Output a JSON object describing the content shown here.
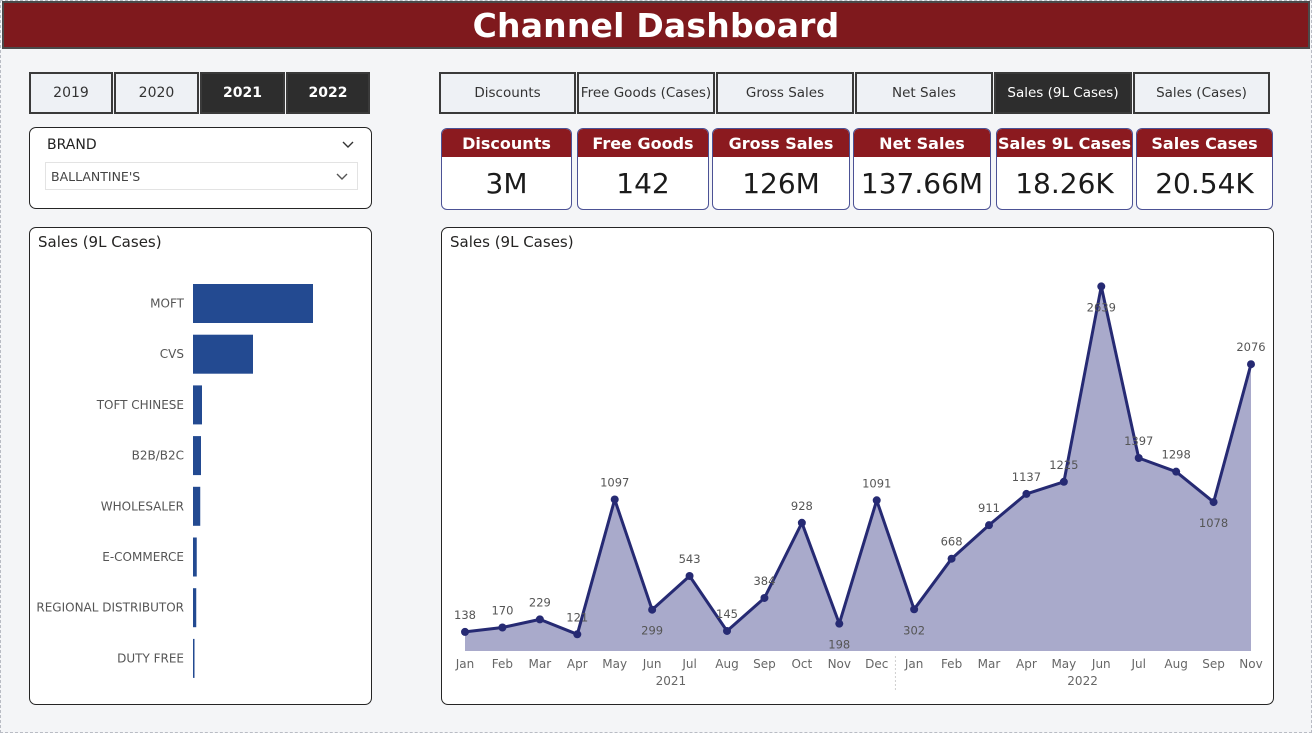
{
  "header": {
    "title": "Channel Dashboard"
  },
  "years": [
    {
      "label": "2019",
      "active": false
    },
    {
      "label": "2020",
      "active": false
    },
    {
      "label": "2021",
      "active": true
    },
    {
      "label": "2022",
      "active": true
    }
  ],
  "metric_tabs": [
    {
      "label": "Discounts",
      "active": false
    },
    {
      "label": "Free Goods (Cases)",
      "active": false
    },
    {
      "label": "Gross Sales",
      "active": false
    },
    {
      "label": "Net Sales",
      "active": false
    },
    {
      "label": "Sales (9L Cases)",
      "active": true
    },
    {
      "label": "Sales (Cases)",
      "active": false
    }
  ],
  "slicer": {
    "title": "BRAND",
    "selected": "BALLANTINE'S"
  },
  "cards": [
    {
      "label": "Discounts",
      "value": "3M"
    },
    {
      "label": "Free Goods",
      "value": "142"
    },
    {
      "label": "Gross Sales",
      "value": "126M"
    },
    {
      "label": "Net Sales",
      "value": "137.66M"
    },
    {
      "label": "Sales 9L Cases",
      "value": "18.26K"
    },
    {
      "label": "Sales Cases",
      "value": "20.54K"
    }
  ],
  "colors": {
    "title_bar": "#7f191d",
    "card_header": "#8b1a1f",
    "bar": "#234a91",
    "line": "#262a73",
    "area": "#a9aacb"
  },
  "chart_data": [
    {
      "type": "bar",
      "orientation": "horizontal",
      "title": "Sales (9L Cases)",
      "categories": [
        "MOFT",
        "CVS",
        "TOFT CHINESE",
        "B2B/B2C",
        "WHOLESALER",
        "E-COMMERCE",
        "REGIONAL DISTRIBUTOR",
        "DUTY FREE"
      ],
      "values": [
        9600,
        4800,
        720,
        640,
        580,
        300,
        260,
        120
      ]
    },
    {
      "type": "area",
      "title": "Sales (9L Cases)",
      "x_level1": [
        "Jan",
        "Feb",
        "Mar",
        "Apr",
        "May",
        "Jun",
        "Jul",
        "Aug",
        "Sep",
        "Oct",
        "Nov",
        "Dec",
        "Jan",
        "Feb",
        "Mar",
        "Apr",
        "May",
        "Jun",
        "Jul",
        "Aug",
        "Sep",
        "Nov"
      ],
      "x_level2": [
        {
          "label": "2021",
          "from": 0,
          "to": 11
        },
        {
          "label": "2022",
          "from": 12,
          "to": 21
        }
      ],
      "values": [
        138,
        170,
        229,
        121,
        1097,
        299,
        543,
        145,
        384,
        928,
        198,
        1091,
        302,
        668,
        911,
        1137,
        1225,
        2639,
        1397,
        1298,
        1078,
        2076
      ],
      "labels": [
        "138",
        "170",
        "229",
        "121",
        "1097",
        "299",
        "543",
        "145",
        "384",
        "928",
        "198",
        "1091",
        "302",
        "668",
        "911",
        "1137",
        "1225",
        "2639",
        "1397",
        "1298",
        "1078",
        "2076"
      ],
      "label_pos": [
        "above",
        "above",
        "above",
        "above",
        "above",
        "below",
        "above",
        "above",
        "above",
        "above",
        "below",
        "above",
        "below",
        "above",
        "above",
        "above",
        "above",
        "below",
        "above",
        "above",
        "below",
        "above"
      ],
      "ylim": [
        0,
        2700
      ]
    }
  ]
}
